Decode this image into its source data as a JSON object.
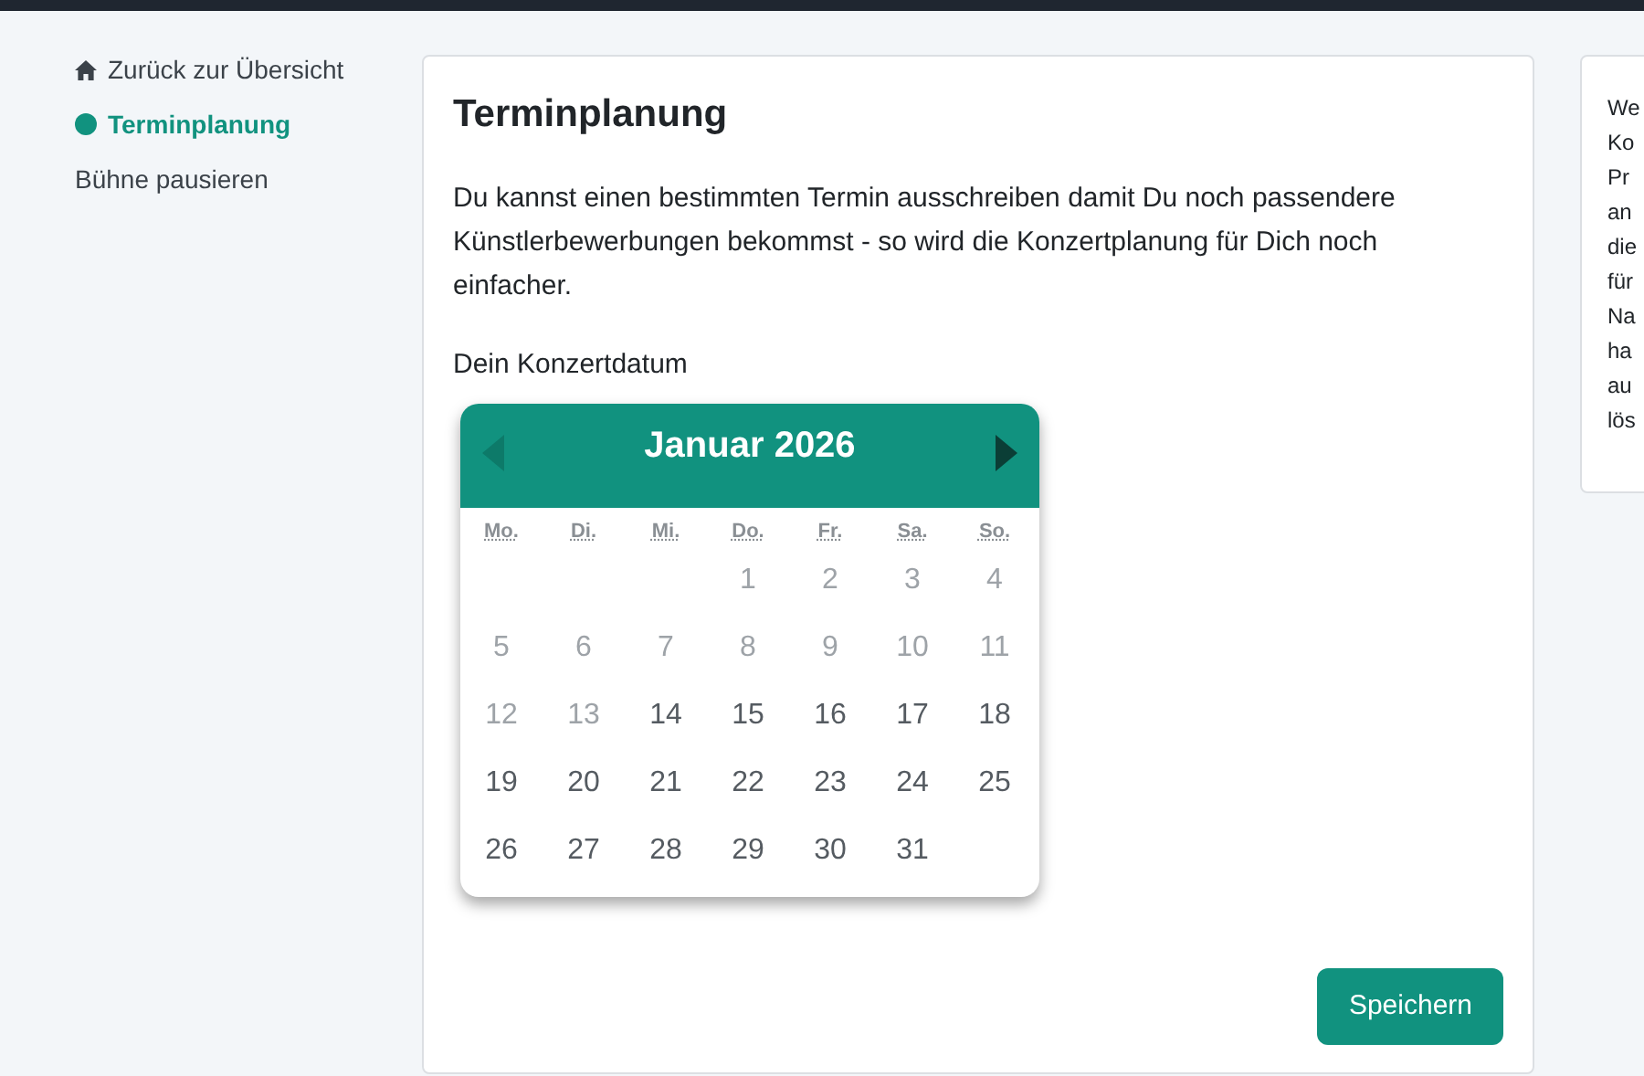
{
  "sidebar": {
    "items": [
      {
        "kind": "home",
        "label": "Zurück zur Übersicht",
        "selected": false
      },
      {
        "kind": "dot",
        "label": "Terminplanung",
        "selected": true
      },
      {
        "kind": "plain",
        "label": "Bühne pausieren",
        "selected": false
      }
    ]
  },
  "main": {
    "title": "Terminplanung",
    "intro": "Du kannst einen bestimmten Termin ausschreiben damit Du noch passendere Künstlerbewerbungen bekommst - so wird die Konzertplanung für Dich noch einfacher.",
    "date_label": "Dein Konzertdatum",
    "calendar": {
      "month": "Januar 2026",
      "prev": {
        "disabled": true
      },
      "next": {
        "disabled": false
      },
      "weekdays": [
        "Mo.",
        "Di.",
        "Mi.",
        "Do.",
        "Fr.",
        "Sa.",
        "So."
      ],
      "weeks": [
        [
          {
            "day": "1",
            "disabled": true
          },
          {
            "day": "2",
            "disabled": true
          },
          {
            "day": "3",
            "disabled": true
          },
          {
            "day": "4",
            "disabled": true
          }
        ],
        [
          {
            "day": "5",
            "disabled": true
          },
          {
            "day": "6",
            "disabled": true
          },
          {
            "day": "7",
            "disabled": true
          },
          {
            "day": "8",
            "disabled": true
          },
          {
            "day": "9",
            "disabled": true
          },
          {
            "day": "10",
            "disabled": true
          },
          {
            "day": "11",
            "disabled": true
          }
        ],
        [
          {
            "day": "12",
            "disabled": true
          },
          {
            "day": "13",
            "disabled": true
          },
          {
            "day": "14",
            "disabled": false
          },
          {
            "day": "15",
            "disabled": false
          },
          {
            "day": "16",
            "disabled": false
          },
          {
            "day": "17",
            "disabled": false
          },
          {
            "day": "18",
            "disabled": false
          }
        ],
        [
          {
            "day": "19",
            "disabled": false
          },
          {
            "day": "20",
            "disabled": false
          },
          {
            "day": "21",
            "disabled": false
          },
          {
            "day": "22",
            "disabled": false
          },
          {
            "day": "23",
            "disabled": false
          },
          {
            "day": "24",
            "disabled": false
          },
          {
            "day": "25",
            "disabled": false
          }
        ],
        [
          {
            "day": "26",
            "disabled": false
          },
          {
            "day": "27",
            "disabled": false
          },
          {
            "day": "28",
            "disabled": false
          },
          {
            "day": "29",
            "disabled": false
          },
          {
            "day": "30",
            "disabled": false
          },
          {
            "day": "31",
            "disabled": false
          }
        ]
      ]
    },
    "save_button": "Speichern"
  },
  "side_panel": {
    "lines": [
      "We",
      "Ko",
      "Pr",
      "an",
      "die",
      "für",
      "Na",
      "ha",
      "au",
      "lös"
    ]
  }
}
